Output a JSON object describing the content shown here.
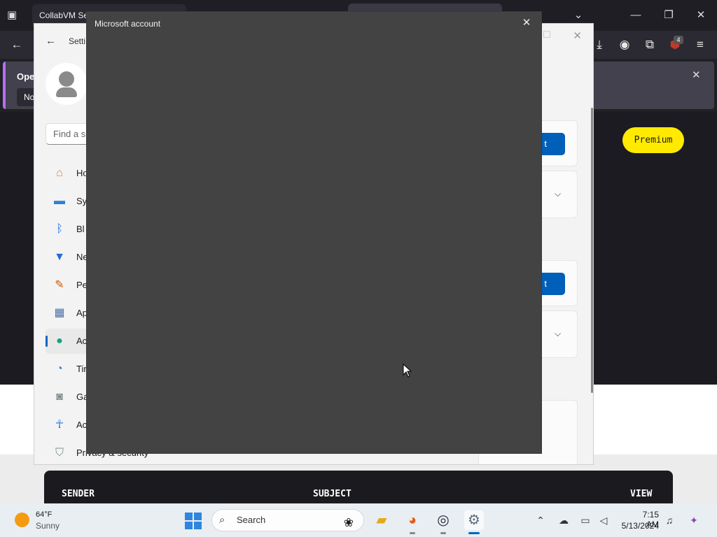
{
  "browser": {
    "tab_title": "CollabVM Se",
    "toolbar_badge": "4",
    "notification": {
      "title": "Oper",
      "button": "No"
    }
  },
  "page": {
    "premium_label": "Premium",
    "table_headers": [
      "SENDER",
      "SUBJECT",
      "VIEW"
    ]
  },
  "settings": {
    "title": "Setti",
    "search_placeholder": "Find a s",
    "nav_items": [
      {
        "label": "Ho",
        "icon": "home-icon"
      },
      {
        "label": "Sy",
        "icon": "system-icon"
      },
      {
        "label": "Bl",
        "icon": "bluetooth-icon"
      },
      {
        "label": "Ne",
        "icon": "wifi-icon"
      },
      {
        "label": "Pe",
        "icon": "brush-icon"
      },
      {
        "label": "Ap",
        "icon": "apps-icon"
      },
      {
        "label": "Ac",
        "icon": "account-icon"
      },
      {
        "label": "Tir",
        "icon": "clock-globe-icon"
      },
      {
        "label": "Ga",
        "icon": "gamepad-icon"
      },
      {
        "label": "Ac",
        "icon": "accessibility-icon"
      },
      {
        "label": "Privacy & security",
        "icon": "shield-icon"
      }
    ],
    "card_button_fragment": "t"
  },
  "dialog": {
    "title": "Microsoft account"
  },
  "taskbar": {
    "weather_temp": "64°F",
    "weather_condition": "Sunny",
    "search_label": "Search",
    "time": "7:15 AM",
    "date": "5/13/2024"
  }
}
